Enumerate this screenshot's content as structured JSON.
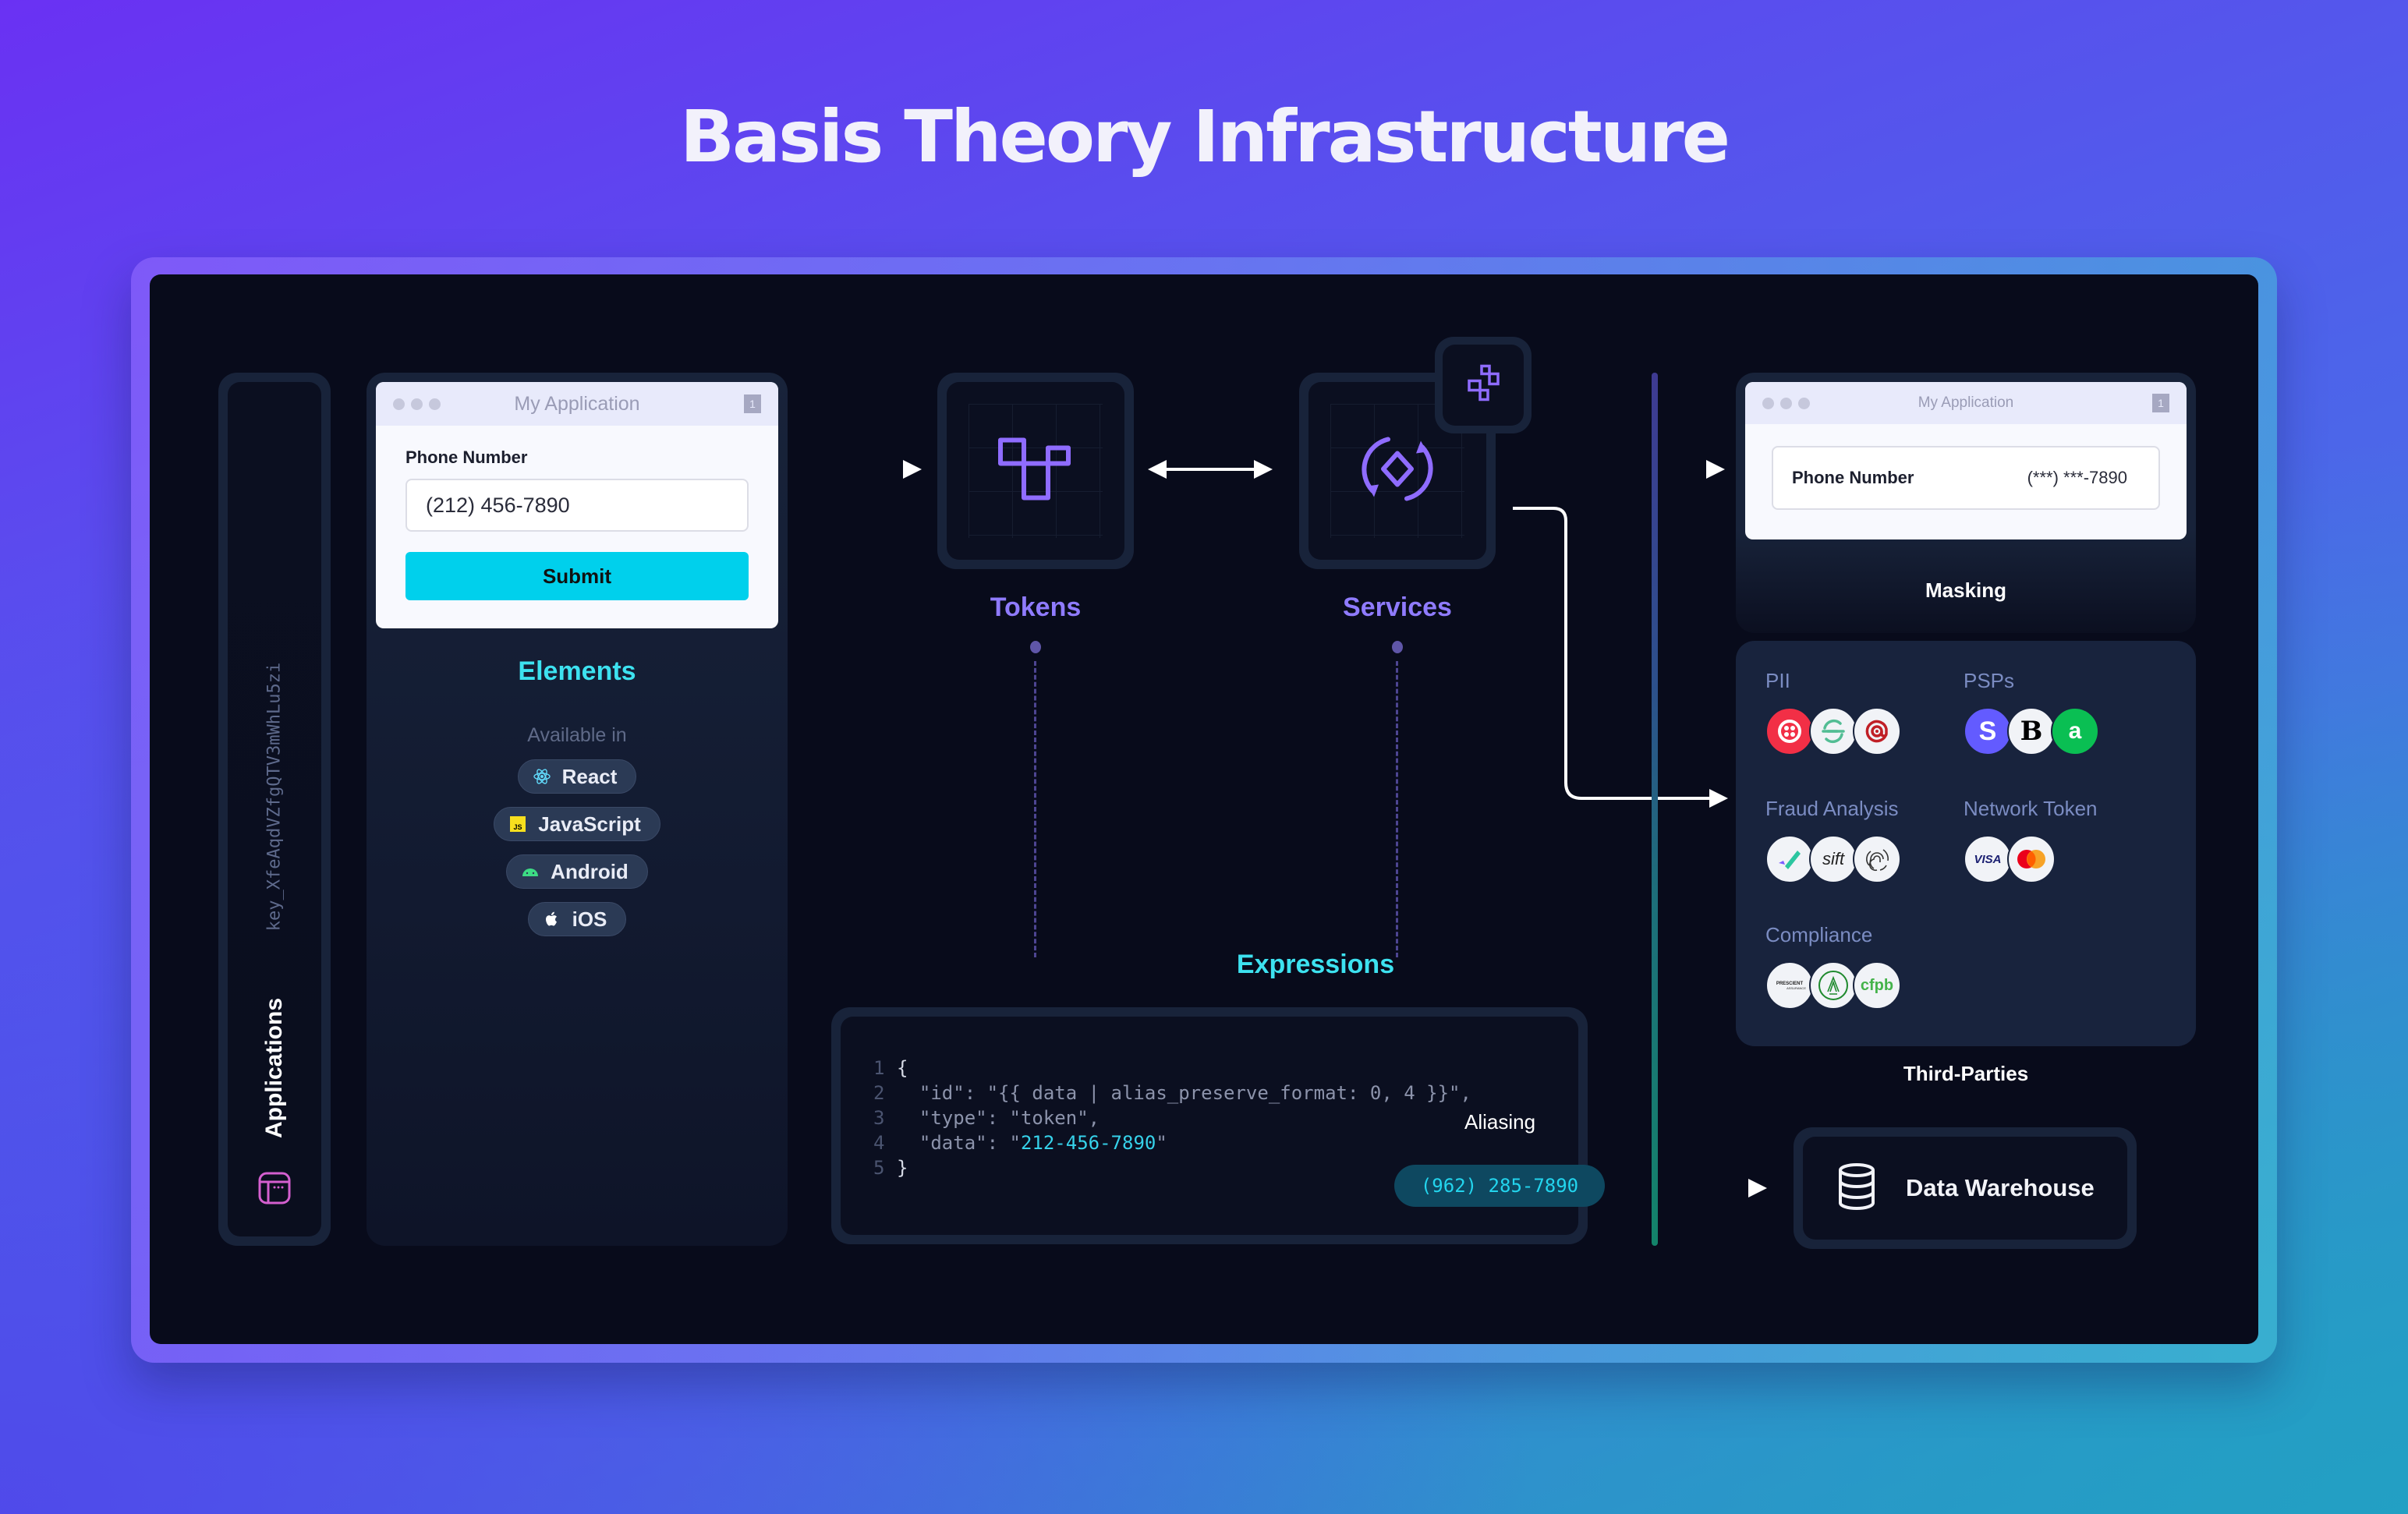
{
  "page": {
    "title": "Basis Theory Infrastructure"
  },
  "applications": {
    "label": "Applications",
    "api_key": "key_XfeAqdVZfgQTV3mWhLu5zi",
    "icon": "browser-window-icon"
  },
  "elements": {
    "window_title": "My Application",
    "window_badge": "1",
    "field_label": "Phone Number",
    "field_value": "(212) 456-7890",
    "submit_label": "Submit",
    "title": "Elements",
    "available_label": "Available in",
    "platforms": [
      {
        "label": "React",
        "icon": "react-icon"
      },
      {
        "label": "JavaScript",
        "icon": "javascript-icon"
      },
      {
        "label": "Android",
        "icon": "android-icon"
      },
      {
        "label": "iOS",
        "icon": "apple-icon"
      }
    ]
  },
  "tokens": {
    "label": "Tokens",
    "icon": "tokens-blocks-icon"
  },
  "services": {
    "label": "Services",
    "icon": "sync-diamond-icon",
    "badge_icon": "modules-icon"
  },
  "expressions": {
    "label": "Expressions",
    "code": [
      {
        "n": "1",
        "text": "{"
      },
      {
        "n": "2",
        "text": "  \"id\": \"{{ data | alias_preserve_format: 0, 4 }}\","
      },
      {
        "n": "3",
        "text": "  \"type\": \"token\","
      },
      {
        "n": "4",
        "pre": "  \"data\": \"",
        "hl": "212-456-7890",
        "post": "\""
      },
      {
        "n": "5",
        "text": "}"
      }
    ],
    "aliasing_label": "Aliasing",
    "alias_value": "(962) 285-7890"
  },
  "masking": {
    "window_title": "My Application",
    "window_badge": "1",
    "field_label": "Phone Number",
    "field_value": "(***) ***-7890",
    "label": "Masking"
  },
  "third_parties": {
    "label": "Third-Parties",
    "groups": [
      {
        "label": "PII",
        "logos": [
          "twilio-logo",
          "segment-logo",
          "mailgun-logo"
        ]
      },
      {
        "label": "PSPs",
        "logos": [
          "stripe-logo",
          "braintree-logo",
          "adyen-logo"
        ]
      },
      {
        "label": "Fraud Analysis",
        "logos": [
          "checkmark-fraud-logo",
          "sift-logo",
          "fingerprint-logo"
        ]
      },
      {
        "label": "Network Token",
        "logos": [
          "visa-logo",
          "mastercard-logo"
        ]
      },
      {
        "label": "Compliance",
        "logos": [
          "prescient-assurance-logo",
          "aicpa-logo",
          "cfpb-logo"
        ]
      }
    ],
    "logo_text": {
      "stripe": "S",
      "braintree": "B",
      "adyen": "a",
      "sift": "sift",
      "visa": "VISA",
      "prescient": "PRESCIENT",
      "prescient_sub": "ASSURANCE",
      "cfpb": "cfpb"
    }
  },
  "data_warehouse": {
    "label": "Data Warehouse",
    "icon": "database-icon"
  },
  "colors": {
    "accent_cyan": "#3de2f0",
    "accent_purple": "#8f7bff",
    "submit": "#00d0ec",
    "canvas": "#080b1b",
    "card": "#18233a"
  }
}
